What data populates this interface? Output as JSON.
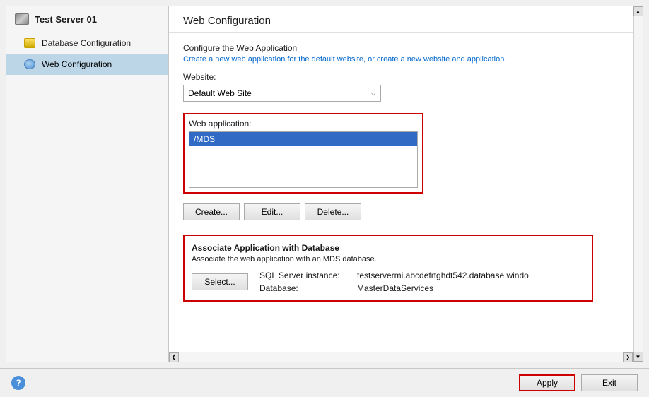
{
  "sidebar": {
    "server_label": "Test Server 01",
    "items": [
      {
        "id": "db-config",
        "label": "Database Configuration",
        "icon": "db-icon",
        "active": false
      },
      {
        "id": "web-config",
        "label": "Web Configuration",
        "icon": "web-icon",
        "active": true
      }
    ]
  },
  "content": {
    "title": "Web Configuration",
    "configure_section": {
      "title": "Configure the Web Application",
      "subtitle": "Create a new web application for the default website, or create a new website and application."
    },
    "website_label": "Website:",
    "website_default": "Default Web Site",
    "web_application_label": "Web application:",
    "web_application_selected": "/MDS",
    "buttons": {
      "create": "Create...",
      "edit": "Edit...",
      "delete": "Delete..."
    },
    "assoc_section": {
      "title": "Associate Application with Database",
      "subtitle": "Associate the web application with an MDS database.",
      "select_button": "Select...",
      "sql_server_label": "SQL Server instance:",
      "sql_server_value": "testservermi.abcdefrtghdt542.database.windo",
      "database_label": "Database:",
      "database_value": "MasterDataServices"
    }
  },
  "bottom_bar": {
    "apply_label": "Apply",
    "exit_label": "Exit",
    "help_label": "?"
  }
}
